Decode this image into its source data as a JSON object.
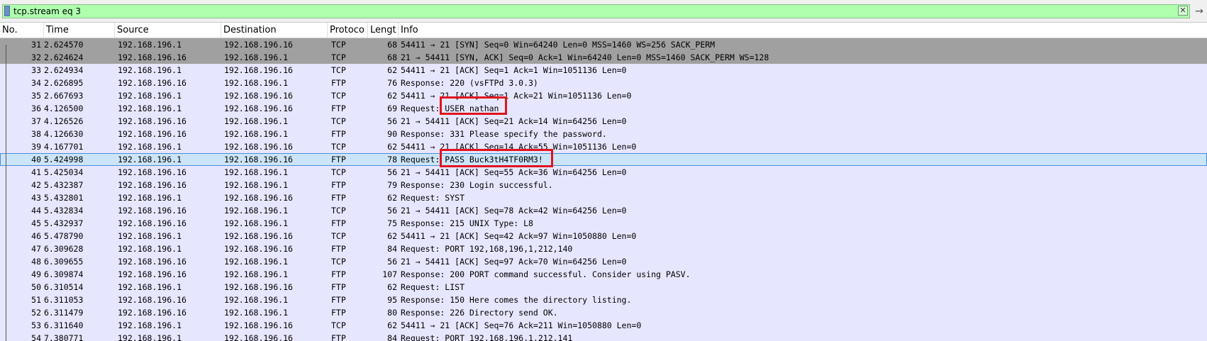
{
  "filter": {
    "value": "tcp.stream eq 3",
    "clear_label": "✕",
    "apply_label": "→"
  },
  "columns": [
    "No.",
    "Time",
    "Source",
    "Destination",
    "Protoco",
    "Lengt",
    "Info"
  ],
  "colors": {
    "filter_bg": "#afffaf",
    "tcp_handshake_bg": "#a0a0a0",
    "row_bg": "#e7e6ff",
    "selected_bg": "#cce4f7",
    "highlight_box": "#e0141e"
  },
  "packets": [
    {
      "no": "31",
      "time": "2.624570",
      "src": "192.168.196.1",
      "dst": "192.168.196.16",
      "proto": "TCP",
      "len": "68",
      "info": "54411 → 21 [SYN] Seq=0 Win=64240 Len=0 MSS=1460 WS=256 SACK_PERM",
      "style": "tcp-syn"
    },
    {
      "no": "32",
      "time": "2.624624",
      "src": "192.168.196.16",
      "dst": "192.168.196.1",
      "proto": "TCP",
      "len": "68",
      "info": "21 → 54411 [SYN, ACK] Seq=0 Ack=1 Win=64240 Len=0 MSS=1460 SACK_PERM WS=128",
      "style": "tcp-syn"
    },
    {
      "no": "33",
      "time": "2.624934",
      "src": "192.168.196.1",
      "dst": "192.168.196.16",
      "proto": "TCP",
      "len": "62",
      "info": "54411 → 21 [ACK] Seq=1 Ack=1 Win=1051136 Len=0",
      "style": "normal"
    },
    {
      "no": "34",
      "time": "2.626895",
      "src": "192.168.196.16",
      "dst": "192.168.196.1",
      "proto": "FTP",
      "len": "76",
      "info": "Response: 220 (vsFTPd 3.0.3)",
      "style": "normal"
    },
    {
      "no": "35",
      "time": "2.667693",
      "src": "192.168.196.1",
      "dst": "192.168.196.16",
      "proto": "TCP",
      "len": "62",
      "info": "54411 → 21 [ACK] Seq=1 Ack=21 Win=1051136 Len=0",
      "style": "normal"
    },
    {
      "no": "36",
      "time": "4.126500",
      "src": "192.168.196.1",
      "dst": "192.168.196.16",
      "proto": "FTP",
      "len": "69",
      "info": "Request: USER nathan",
      "style": "normal"
    },
    {
      "no": "37",
      "time": "4.126526",
      "src": "192.168.196.16",
      "dst": "192.168.196.1",
      "proto": "TCP",
      "len": "56",
      "info": "21 → 54411 [ACK] Seq=21 Ack=14 Win=64256 Len=0",
      "style": "normal"
    },
    {
      "no": "38",
      "time": "4.126630",
      "src": "192.168.196.16",
      "dst": "192.168.196.1",
      "proto": "FTP",
      "len": "90",
      "info": "Response: 331 Please specify the password.",
      "style": "normal"
    },
    {
      "no": "39",
      "time": "4.167701",
      "src": "192.168.196.1",
      "dst": "192.168.196.16",
      "proto": "TCP",
      "len": "62",
      "info": "54411 → 21 [ACK] Seq=14 Ack=55 Win=1051136 Len=0",
      "style": "normal"
    },
    {
      "no": "40",
      "time": "5.424998",
      "src": "192.168.196.1",
      "dst": "192.168.196.16",
      "proto": "FTP",
      "len": "78",
      "info": "Request: PASS Buck3tH4TF0RM3!",
      "style": "selected"
    },
    {
      "no": "41",
      "time": "5.425034",
      "src": "192.168.196.16",
      "dst": "192.168.196.1",
      "proto": "TCP",
      "len": "56",
      "info": "21 → 54411 [ACK] Seq=55 Ack=36 Win=64256 Len=0",
      "style": "normal"
    },
    {
      "no": "42",
      "time": "5.432387",
      "src": "192.168.196.16",
      "dst": "192.168.196.1",
      "proto": "FTP",
      "len": "79",
      "info": "Response: 230 Login successful.",
      "style": "normal"
    },
    {
      "no": "43",
      "time": "5.432801",
      "src": "192.168.196.1",
      "dst": "192.168.196.16",
      "proto": "FTP",
      "len": "62",
      "info": "Request: SYST",
      "style": "normal"
    },
    {
      "no": "44",
      "time": "5.432834",
      "src": "192.168.196.16",
      "dst": "192.168.196.1",
      "proto": "TCP",
      "len": "56",
      "info": "21 → 54411 [ACK] Seq=78 Ack=42 Win=64256 Len=0",
      "style": "normal"
    },
    {
      "no": "45",
      "time": "5.432937",
      "src": "192.168.196.16",
      "dst": "192.168.196.1",
      "proto": "FTP",
      "len": "75",
      "info": "Response: 215 UNIX Type: L8",
      "style": "normal"
    },
    {
      "no": "46",
      "time": "5.478790",
      "src": "192.168.196.1",
      "dst": "192.168.196.16",
      "proto": "TCP",
      "len": "62",
      "info": "54411 → 21 [ACK] Seq=42 Ack=97 Win=1050880 Len=0",
      "style": "normal"
    },
    {
      "no": "47",
      "time": "6.309628",
      "src": "192.168.196.1",
      "dst": "192.168.196.16",
      "proto": "FTP",
      "len": "84",
      "info": "Request: PORT 192,168,196,1,212,140",
      "style": "normal"
    },
    {
      "no": "48",
      "time": "6.309655",
      "src": "192.168.196.16",
      "dst": "192.168.196.1",
      "proto": "TCP",
      "len": "56",
      "info": "21 → 54411 [ACK] Seq=97 Ack=70 Win=64256 Len=0",
      "style": "normal"
    },
    {
      "no": "49",
      "time": "6.309874",
      "src": "192.168.196.16",
      "dst": "192.168.196.1",
      "proto": "FTP",
      "len": "107",
      "info": "Response: 200 PORT command successful. Consider using PASV.",
      "style": "normal"
    },
    {
      "no": "50",
      "time": "6.310514",
      "src": "192.168.196.1",
      "dst": "192.168.196.16",
      "proto": "FTP",
      "len": "62",
      "info": "Request: LIST",
      "style": "normal"
    },
    {
      "no": "51",
      "time": "6.311053",
      "src": "192.168.196.16",
      "dst": "192.168.196.1",
      "proto": "FTP",
      "len": "95",
      "info": "Response: 150 Here comes the directory listing.",
      "style": "normal"
    },
    {
      "no": "52",
      "time": "6.311479",
      "src": "192.168.196.16",
      "dst": "192.168.196.1",
      "proto": "FTP",
      "len": "80",
      "info": "Response: 226 Directory send OK.",
      "style": "normal"
    },
    {
      "no": "53",
      "time": "6.311640",
      "src": "192.168.196.1",
      "dst": "192.168.196.16",
      "proto": "TCP",
      "len": "62",
      "info": "54411 → 21 [ACK] Seq=76 Ack=211 Win=1050880 Len=0",
      "style": "normal"
    },
    {
      "no": "54",
      "time": "7.380771",
      "src": "192.168.196.1",
      "dst": "192.168.196.16",
      "proto": "FTP",
      "len": "84",
      "info": "Request: PORT 192,168,196,1,212,141",
      "style": "normal"
    }
  ]
}
